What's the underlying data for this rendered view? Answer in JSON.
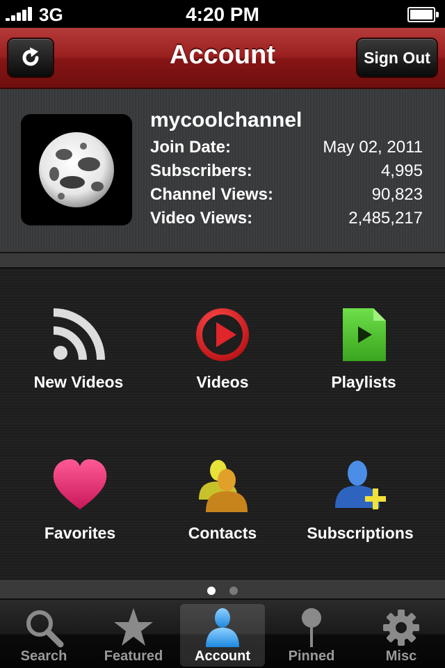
{
  "status_bar": {
    "carrier": "3G",
    "time": "4:20 PM"
  },
  "nav": {
    "title": "Account",
    "refresh_icon": "refresh-icon",
    "sign_out_label": "Sign Out"
  },
  "profile": {
    "channel_name": "mycoolchannel",
    "stats": [
      {
        "label": "Join Date:",
        "value": "May 02, 2011"
      },
      {
        "label": "Subscribers:",
        "value": "4,995"
      },
      {
        "label": "Channel Views:",
        "value": "90,823"
      },
      {
        "label": "Video Views:",
        "value": "2,485,217"
      }
    ]
  },
  "grid": {
    "items": [
      {
        "label": "New Videos",
        "icon": "rss-icon"
      },
      {
        "label": "Videos",
        "icon": "play-icon"
      },
      {
        "label": "Playlists",
        "icon": "playlist-icon"
      },
      {
        "label": "Favorites",
        "icon": "heart-icon"
      },
      {
        "label": "Contacts",
        "icon": "contacts-icon"
      },
      {
        "label": "Subscriptions",
        "icon": "add-user-icon"
      }
    ]
  },
  "pager": {
    "current_page": 1,
    "page_count": 2
  },
  "tabs": [
    {
      "label": "Search",
      "icon": "search-icon"
    },
    {
      "label": "Featured",
      "icon": "star-icon"
    },
    {
      "label": "Account",
      "icon": "person-icon",
      "active": true
    },
    {
      "label": "Pinned",
      "icon": "pin-icon"
    },
    {
      "label": "Misc",
      "icon": "gear-icon"
    }
  ],
  "colors": {
    "nav_red": "#9a1f1f",
    "play_red": "#e0262b",
    "playlist_green": "#4dbf2c",
    "heart_pink": "#e0306a",
    "active_tab_blue": "#3aa0e8"
  }
}
